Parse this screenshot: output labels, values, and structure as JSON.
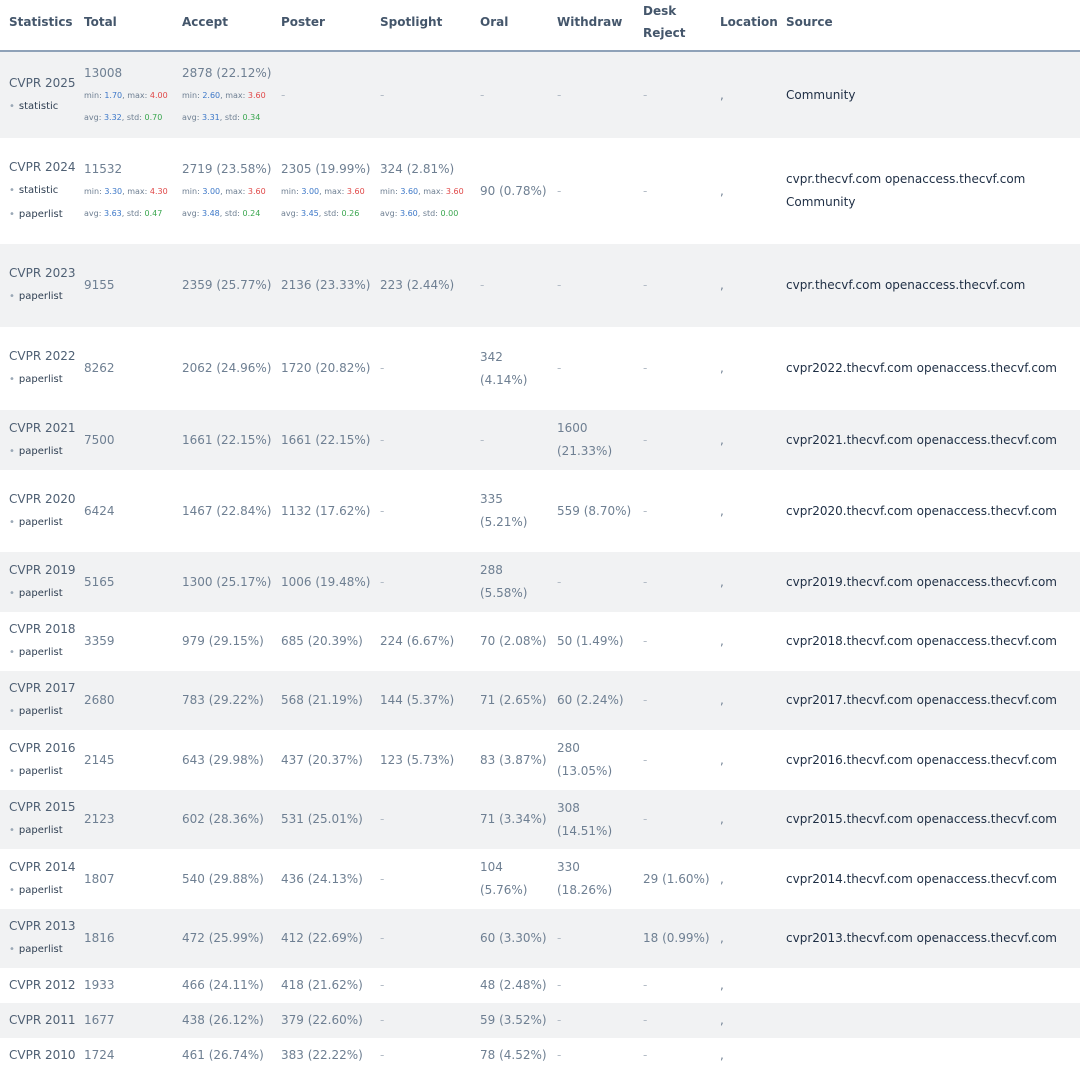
{
  "header": {
    "statistics": "Statistics",
    "total": "Total",
    "accept": "Accept",
    "poster": "Poster",
    "spotlight": "Spotlight",
    "oral": "Oral",
    "withdraw": "Withdraw",
    "desk_reject": "Desk Reject",
    "location": "Location",
    "source": "Source"
  },
  "rows": [
    {
      "name": "CVPR 2025",
      "links": [
        "statistic"
      ],
      "total": "13008",
      "total_stats": {
        "min": "1.70",
        "max": "4.00",
        "avg": "3.32",
        "std": "0.70"
      },
      "accept": "2878 (22.12%)",
      "accept_stats": {
        "min": "2.60",
        "max": "3.60",
        "avg": "3.31",
        "std": "0.34"
      },
      "poster": "-",
      "spotlight": "-",
      "oral": "-",
      "withdraw": "-",
      "desk_reject": "-",
      "location": ",",
      "source": "Community"
    },
    {
      "name": "CVPR 2024",
      "links": [
        "statistic",
        "paperlist"
      ],
      "total": "11532",
      "total_stats": {
        "min": "3.30",
        "max": "4.30",
        "avg": "3.63",
        "std": "0.47"
      },
      "accept": "2719 (23.58%)",
      "accept_stats": {
        "min": "3.00",
        "max": "3.60",
        "avg": "3.48",
        "std": "0.24"
      },
      "poster": "2305 (19.99%)",
      "poster_stats": {
        "min": "3.00",
        "max": "3.60",
        "avg": "3.45",
        "std": "0.26"
      },
      "spotlight": "324 (2.81%)",
      "spotlight_stats": {
        "min": "3.60",
        "max": "3.60",
        "avg": "3.60",
        "std": "0.00"
      },
      "oral": "90 (0.78%)",
      "withdraw": "-",
      "desk_reject": "-",
      "location": ",",
      "source": "cvpr.thecvf.com openaccess.thecvf.com Community"
    },
    {
      "name": "CVPR 2023",
      "links": [
        "paperlist"
      ],
      "total": "9155",
      "accept": "2359 (25.77%)",
      "poster": "2136 (23.33%)",
      "spotlight": "223 (2.44%)",
      "oral": "-",
      "withdraw": "-",
      "desk_reject": "-",
      "location": ",",
      "source": "cvpr.thecvf.com openaccess.thecvf.com"
    },
    {
      "name": "CVPR 2022",
      "links": [
        "paperlist"
      ],
      "total": "8262",
      "accept": "2062 (24.96%)",
      "poster": "1720 (20.82%)",
      "spotlight": "-",
      "oral": "342 (4.14%)",
      "withdraw": "-",
      "desk_reject": "-",
      "location": ",",
      "source": "cvpr2022.thecvf.com openaccess.thecvf.com"
    },
    {
      "name": "CVPR 2021",
      "links": [
        "paperlist"
      ],
      "total": "7500",
      "accept": "1661 (22.15%)",
      "poster": "1661 (22.15%)",
      "spotlight": "-",
      "oral": "-",
      "withdraw": "1600 (21.33%)",
      "desk_reject": "-",
      "location": ",",
      "source": "cvpr2021.thecvf.com openaccess.thecvf.com"
    },
    {
      "name": "CVPR 2020",
      "links": [
        "paperlist"
      ],
      "total": "6424",
      "accept": "1467 (22.84%)",
      "poster": "1132 (17.62%)",
      "spotlight": "-",
      "oral": "335 (5.21%)",
      "withdraw": "559 (8.70%)",
      "desk_reject": "-",
      "location": ",",
      "source": "cvpr2020.thecvf.com openaccess.thecvf.com"
    },
    {
      "name": "CVPR 2019",
      "links": [
        "paperlist"
      ],
      "total": "5165",
      "accept": "1300 (25.17%)",
      "poster": "1006 (19.48%)",
      "spotlight": "-",
      "oral": "288 (5.58%)",
      "withdraw": "-",
      "desk_reject": "-",
      "location": ",",
      "source": "cvpr2019.thecvf.com openaccess.thecvf.com"
    },
    {
      "name": "CVPR 2018",
      "links": [
        "paperlist"
      ],
      "total": "3359",
      "accept": "979 (29.15%)",
      "poster": "685 (20.39%)",
      "spotlight": "224 (6.67%)",
      "oral": "70 (2.08%)",
      "withdraw": "50 (1.49%)",
      "desk_reject": "-",
      "location": ",",
      "source": "cvpr2018.thecvf.com openaccess.thecvf.com"
    },
    {
      "name": "CVPR 2017",
      "links": [
        "paperlist"
      ],
      "total": "2680",
      "accept": "783 (29.22%)",
      "poster": "568 (21.19%)",
      "spotlight": "144 (5.37%)",
      "oral": "71 (2.65%)",
      "withdraw": "60 (2.24%)",
      "desk_reject": "-",
      "location": ",",
      "source": "cvpr2017.thecvf.com openaccess.thecvf.com"
    },
    {
      "name": "CVPR 2016",
      "links": [
        "paperlist"
      ],
      "total": "2145",
      "accept": "643 (29.98%)",
      "poster": "437 (20.37%)",
      "spotlight": "123 (5.73%)",
      "oral": "83 (3.87%)",
      "withdraw": "280 (13.05%)",
      "desk_reject": "-",
      "location": ",",
      "source": "cvpr2016.thecvf.com openaccess.thecvf.com"
    },
    {
      "name": "CVPR 2015",
      "links": [
        "paperlist"
      ],
      "total": "2123",
      "accept": "602 (28.36%)",
      "poster": "531 (25.01%)",
      "spotlight": "-",
      "oral": "71 (3.34%)",
      "withdraw": "308 (14.51%)",
      "desk_reject": "-",
      "location": ",",
      "source": "cvpr2015.thecvf.com openaccess.thecvf.com"
    },
    {
      "name": "CVPR 2014",
      "links": [
        "paperlist"
      ],
      "total": "1807",
      "accept": "540 (29.88%)",
      "poster": "436 (24.13%)",
      "spotlight": "-",
      "oral": "104 (5.76%)",
      "withdraw": "330 (18.26%)",
      "desk_reject": "29 (1.60%)",
      "location": ",",
      "source": "cvpr2014.thecvf.com openaccess.thecvf.com"
    },
    {
      "name": "CVPR 2013",
      "links": [
        "paperlist"
      ],
      "total": "1816",
      "accept": "472 (25.99%)",
      "poster": "412 (22.69%)",
      "spotlight": "-",
      "oral": "60 (3.30%)",
      "withdraw": "-",
      "desk_reject": "18 (0.99%)",
      "location": ",",
      "source": "cvpr2013.thecvf.com openaccess.thecvf.com"
    },
    {
      "name": "CVPR 2012",
      "links": [],
      "total": "1933",
      "accept": "466 (24.11%)",
      "poster": "418 (21.62%)",
      "spotlight": "-",
      "oral": "48 (2.48%)",
      "withdraw": "-",
      "desk_reject": "-",
      "location": ",",
      "source": ""
    },
    {
      "name": "CVPR 2011",
      "links": [],
      "total": "1677",
      "accept": "438 (26.12%)",
      "poster": "379 (22.60%)",
      "spotlight": "-",
      "oral": "59 (3.52%)",
      "withdraw": "-",
      "desk_reject": "-",
      "location": ",",
      "source": ""
    },
    {
      "name": "CVPR 2010",
      "links": [],
      "total": "1724",
      "accept": "461 (26.74%)",
      "poster": "383 (22.22%)",
      "spotlight": "-",
      "oral": "78 (4.52%)",
      "withdraw": "-",
      "desk_reject": "-",
      "location": ",",
      "source": ""
    }
  ]
}
